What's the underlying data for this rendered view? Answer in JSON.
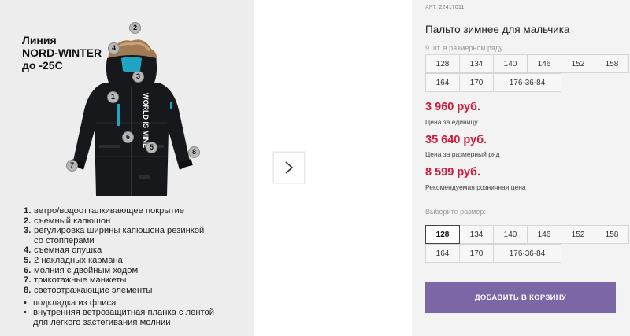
{
  "product_image": {
    "line_title": [
      "Линия",
      "NORD-WINTER",
      "до -25С"
    ],
    "jacket_print": "WORLD IS MINE",
    "markers": [
      "1",
      "2",
      "3",
      "4",
      "5",
      "6",
      "7",
      "8"
    ],
    "features": [
      {
        "num": "1.",
        "text": "ветро/водоотталкивающее покрытие"
      },
      {
        "num": "2.",
        "text": "съемный капюшон"
      },
      {
        "num": "3.",
        "text": "регулировка ширины капюшона  резинкой",
        "cont": "со стопперами"
      },
      {
        "num": "4.",
        "text": "съемная опушка"
      },
      {
        "num": "5.",
        "text": "2 накладных кармана"
      },
      {
        "num": "6.",
        "text": "молния с двойным ходом"
      },
      {
        "num": "7.",
        "text": "трикотажные манжеты"
      },
      {
        "num": "8.",
        "text": "светоотражающие элементы"
      }
    ],
    "extras": [
      {
        "bullet": "•",
        "text": "подкладка из флиса"
      },
      {
        "bullet": "•",
        "text": "внутренняя ветрозащитная планка с лентой",
        "cont": "для легкого застегивания молнии"
      }
    ]
  },
  "gallery": {
    "next_icon": "chevron-right-icon"
  },
  "product": {
    "art_label": "АРТ.",
    "art_value": "22417011",
    "title": "Пальто зимнее для мальчика",
    "row_hint": "9 шт. в размерном ряду",
    "row_sizes": [
      "128",
      "134",
      "140",
      "146",
      "152",
      "158",
      "164",
      "170",
      "176-36-84"
    ],
    "price_unit": "3 960 руб.",
    "price_unit_note": "Цена за единицу",
    "price_row": "35 640 руб.",
    "price_row_note": "Цена за размерный ряд",
    "price_retail": "8 599 руб.",
    "price_retail_note": "Рекомендуемая розничная цена",
    "select_hint": "Выберите размер:",
    "select_sizes": [
      "128",
      "134",
      "140",
      "146",
      "152",
      "158",
      "164",
      "170",
      "176-36-84"
    ],
    "selected_size": "128",
    "cart_button": "Добавить в корзину"
  },
  "colors": {
    "price": "#d3183a",
    "cart_button": "#7b66a6",
    "image_bg": "#ededed",
    "info_bg": "#f3f3f3",
    "jacket": "#16181c",
    "accent_blue": "#1fa4c4"
  }
}
